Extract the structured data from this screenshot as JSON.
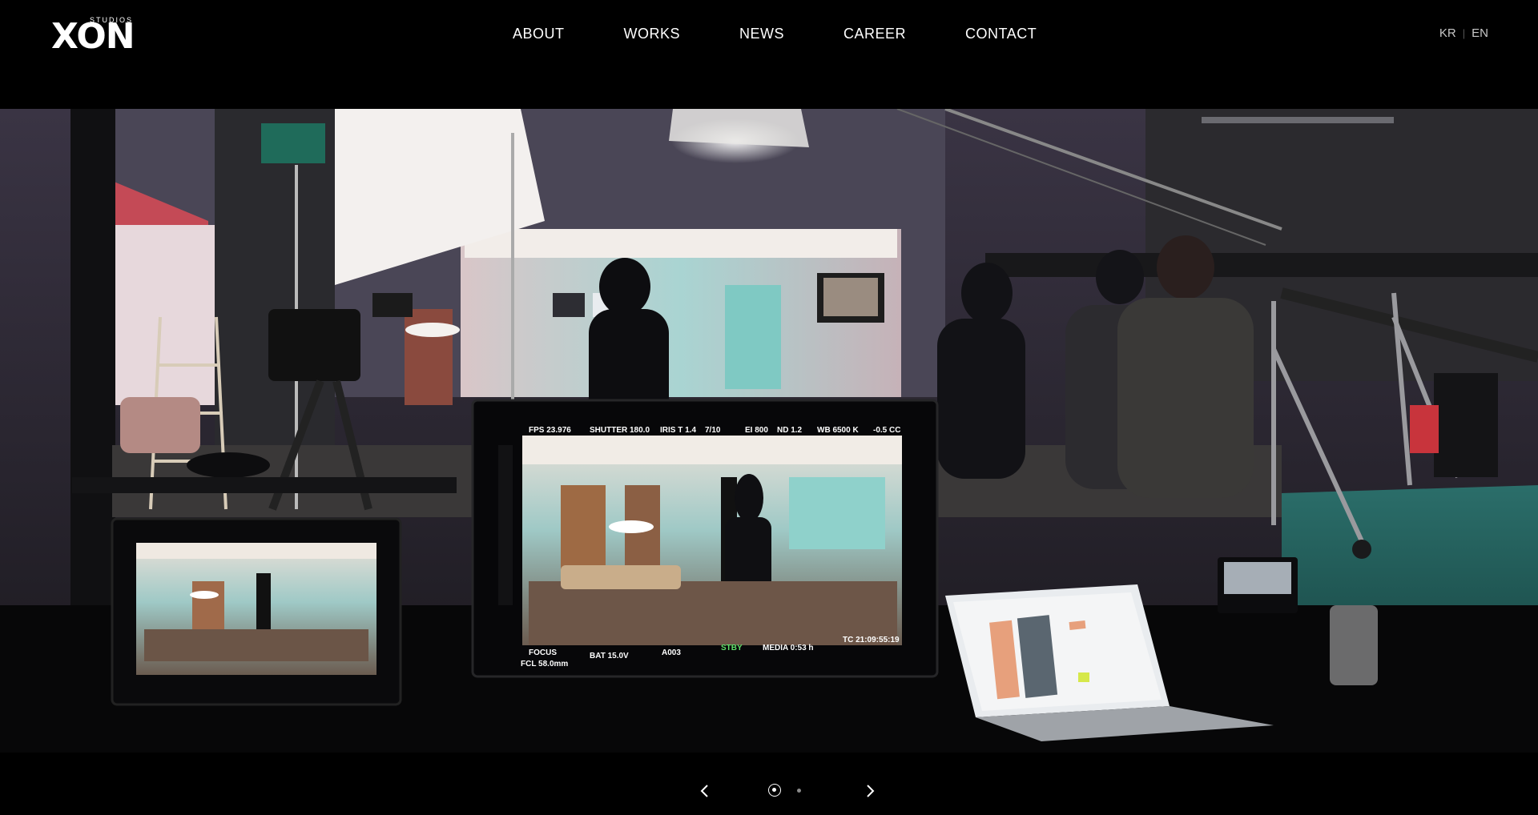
{
  "header": {
    "logo": {
      "small_text": "STUDIOS",
      "main_text": "XON"
    },
    "nav": [
      {
        "label": "ABOUT"
      },
      {
        "label": "WORKS"
      },
      {
        "label": "NEWS"
      },
      {
        "label": "CAREER"
      },
      {
        "label": "CONTACT"
      }
    ],
    "languages": [
      {
        "label": "KR"
      },
      {
        "label": "EN"
      }
    ],
    "lang_separator": "|"
  },
  "hero": {
    "slide_count": 2,
    "active_slide": 1,
    "monitor_main": {
      "fps": "FPS 23.976",
      "shutter": "SHUTTER 180.0",
      "iris": "IRIS T 1.4",
      "frac": "7/10",
      "ei": "EI 800",
      "nd": "ND 1.2",
      "wb": "WB 6500 K",
      "cc": "-0.5 CC",
      "focus": "FOCUS",
      "fcl": "FCL 58.0mm",
      "bat": "BAT 15.0V",
      "clip": "A003",
      "stby": "STBY",
      "media": "MEDIA 0:53 h",
      "tc": "TC 21:09:55:19"
    }
  },
  "carousel": {
    "prev_icon": "chevron-left-icon",
    "next_icon": "chevron-right-icon"
  },
  "colors": {
    "background": "#000000",
    "nav_text": "#ffffff",
    "lang_text": "#c8c8c8",
    "dot_inactive": "#8a8a8a"
  }
}
